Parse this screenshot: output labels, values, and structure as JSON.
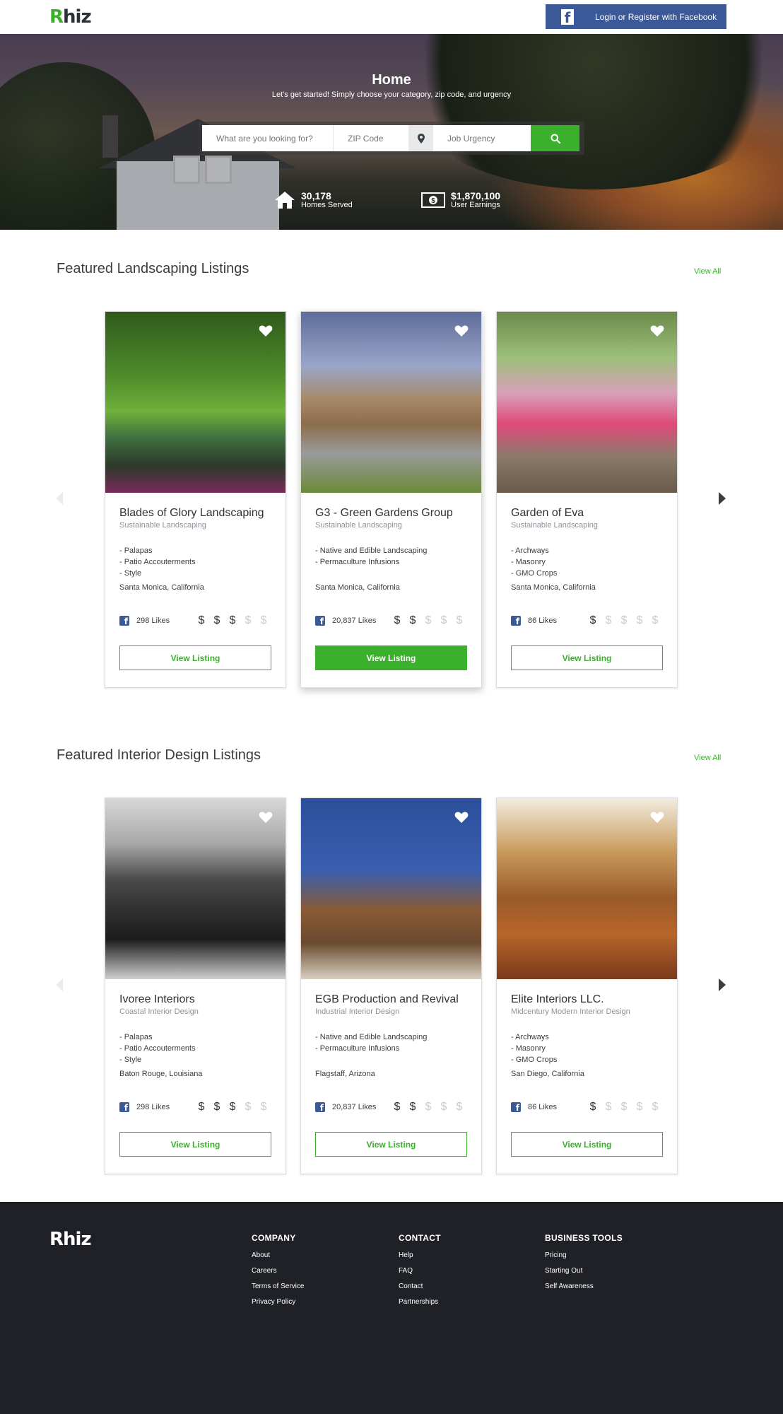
{
  "header": {
    "logo": "Rhiz",
    "fb_button": "Login or Register with Facebook",
    "fb_glyph": "f"
  },
  "hero": {
    "title": "Home",
    "subtitle": "Let's get started! Simply choose your category, zip code, and urgency",
    "search": {
      "what_placeholder": "What are you looking for?",
      "zip_placeholder": "ZIP Code",
      "urgency_placeholder": "Job Urgency"
    },
    "stats": [
      {
        "value": "30,178",
        "label": "Homes Served",
        "icon": "house-icon"
      },
      {
        "value": "$1,870,100",
        "label": "User Earnings",
        "icon": "money-icon"
      }
    ]
  },
  "sections": [
    {
      "title": "Featured Landscaping Listings",
      "view_all": "View All",
      "cards": [
        {
          "name": "Blades of Glory Landscaping",
          "category": "Sustainable Landscaping",
          "features": [
            "- Palapas",
            "- Patio Accouterments",
            "- Style"
          ],
          "location": "Santa Monica, California",
          "likes": "298 Likes",
          "price_level": 3,
          "button": "View Listing"
        },
        {
          "name": "G3 - Green Gardens Group",
          "category": "Sustainable Landscaping",
          "features": [
            "- Native and Edible Landscaping",
            "- Permaculture Infusions"
          ],
          "location": "Santa Monica, California",
          "likes": "20,837 Likes",
          "price_level": 2,
          "button": "View Listing"
        },
        {
          "name": "Garden of Eva",
          "category": "Sustainable Landscaping",
          "features": [
            "- Archways",
            "- Masonry",
            "- GMO Crops"
          ],
          "location": "Santa Monica, California",
          "likes": "86 Likes",
          "price_level": 1,
          "button": "View Listing"
        }
      ]
    },
    {
      "title": "Featured Interior Design Listings",
      "view_all": "View All",
      "cards": [
        {
          "name": "Ivoree Interiors",
          "category": "Coastal Interior Design",
          "features": [
            "- Palapas",
            "- Patio Accouterments",
            "- Style"
          ],
          "location": "Baton Rouge, Louisiana",
          "likes": "298 Likes",
          "price_level": 3,
          "button": "View Listing"
        },
        {
          "name": "EGB Production and Revival",
          "category": "Industrial Interior Design",
          "features": [
            "- Native and Edible Landscaping",
            "- Permaculture Infusions"
          ],
          "location": "Flagstaff, Arizona",
          "likes": "20,837 Likes",
          "price_level": 2,
          "button": "View Listing"
        },
        {
          "name": "Elite Interiors LLC.",
          "category": "Midcentury Modern Interior Design",
          "features": [
            "- Archways",
            "- Masonry",
            "- GMO Crops"
          ],
          "location": "San Diego, California",
          "likes": "86 Likes",
          "price_level": 1,
          "button": "View Listing"
        }
      ]
    }
  ],
  "price_symbol": "$",
  "footer": {
    "logo": "Rhiz",
    "columns": [
      {
        "heading": "COMPANY",
        "links": [
          "About",
          "Careers",
          "Terms of Service",
          "Privacy Policy"
        ]
      },
      {
        "heading": "CONTACT",
        "links": [
          "Help",
          "FAQ",
          "Contact",
          "Partnerships"
        ]
      },
      {
        "heading": "BUSINESS TOOLS",
        "links": [
          "Pricing",
          "Starting Out",
          "Self Awareness"
        ]
      }
    ]
  },
  "colors": {
    "brand_green": "#3bb02c",
    "facebook_blue": "#3b5998",
    "footer_bg": "#1f2126"
  }
}
